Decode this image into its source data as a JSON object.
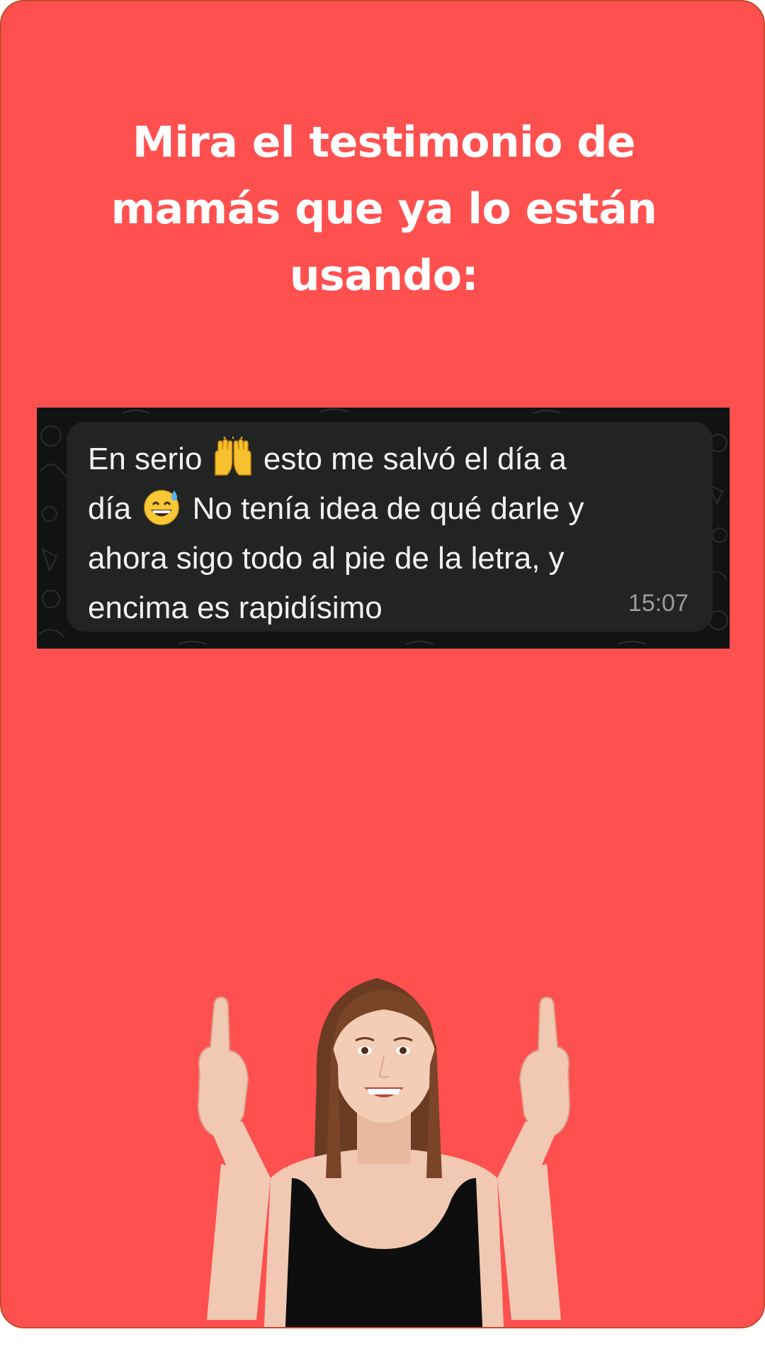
{
  "headline": {
    "line1": "Mira el testimonio de",
    "line2": "mamás que ya lo están",
    "line3": "usando:"
  },
  "testimonial": {
    "segment1": "En serio ",
    "emoji1": "raising-hands-emoji",
    "segment2": " esto me salvó el día a",
    "segment3": "día ",
    "emoji2": "grinning-sweat-emoji",
    "segment4": " No tenía idea de qué darle y",
    "segment5": "ahora sigo todo al pie de la letra, y",
    "segment6": "encima es rapidísimo",
    "time": "15:07"
  },
  "colors": {
    "background": "#FF5050",
    "bubble": "#222424",
    "chat_bg": "#101312"
  },
  "image": {
    "subject": "smiling-woman-pointing-up"
  }
}
